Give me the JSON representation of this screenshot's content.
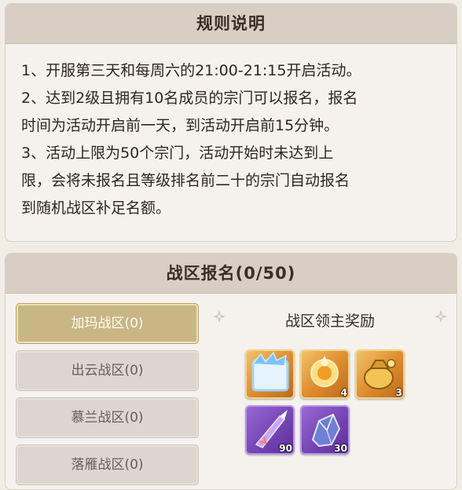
{
  "rules": {
    "title": "规则说明",
    "lines": [
      "1、开服第三天和每周六的21:00-21:15开启活动。",
      "2、达到2级且拥有10名成员的宗门可以报名，报名",
      "时间为活动开启前一天，到活动开启前15分钟。",
      "3、活动上限为50个宗门，活动开始时未达到上",
      "限，会将未报名且等级排名前二十的宗门自动报名",
      "到随机战区补足名额。"
    ]
  },
  "signup": {
    "title": "战区报名(0/50)",
    "zones": [
      {
        "label": "加玛战区(0)",
        "active": true
      },
      {
        "label": "出云战区(0)",
        "active": false
      },
      {
        "label": "慕兰战区(0)",
        "active": false
      },
      {
        "label": "落雁战区(0)",
        "active": false
      }
    ],
    "reward_title": "战区领主奖励",
    "rewards": [
      {
        "icon": "ice-frame-icon",
        "rarity": "gold",
        "count": ""
      },
      {
        "icon": "gold-orb-icon",
        "rarity": "gold",
        "count": "4"
      },
      {
        "icon": "gold-pouch-icon",
        "rarity": "gold",
        "count": "3"
      },
      {
        "icon": "purple-spear-icon",
        "rarity": "purple",
        "count": "90"
      },
      {
        "icon": "crystal-ore-icon",
        "rarity": "purple",
        "count": "30"
      }
    ]
  },
  "colors": {
    "header_bg": "#d8cec4",
    "active_tab": "#c8b684",
    "inactive_tab": "#ddd6cf",
    "gold_frame": "#dd8a2c",
    "purple_frame": "#7445b5"
  }
}
